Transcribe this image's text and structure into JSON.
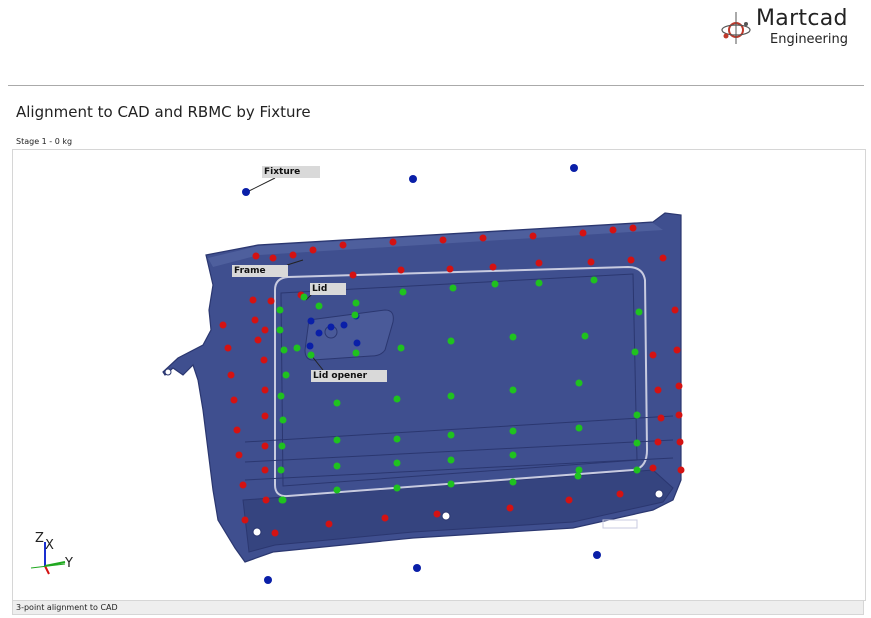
{
  "brand": {
    "name": "Martcad",
    "subtitle": "Engineering"
  },
  "report": {
    "title": "Alignment to CAD and RBMC by Fixture",
    "stage": "Stage 1 - 0 kg",
    "footer": "3-point alignment to CAD"
  },
  "viewport": {
    "labels": {
      "fixture": "Fixture",
      "frame": "Frame",
      "lid": "Lid",
      "lid_opener": "Lid opener"
    },
    "axes": {
      "z": "Z",
      "x": "X",
      "y": "Y"
    }
  },
  "colors": {
    "part": "#3f4f8f",
    "fixture_points": "#0a1fa8",
    "frame_points": "#d41212",
    "lid_points": "#1fc21f",
    "lid_opener_points": "#0a1fa8"
  }
}
